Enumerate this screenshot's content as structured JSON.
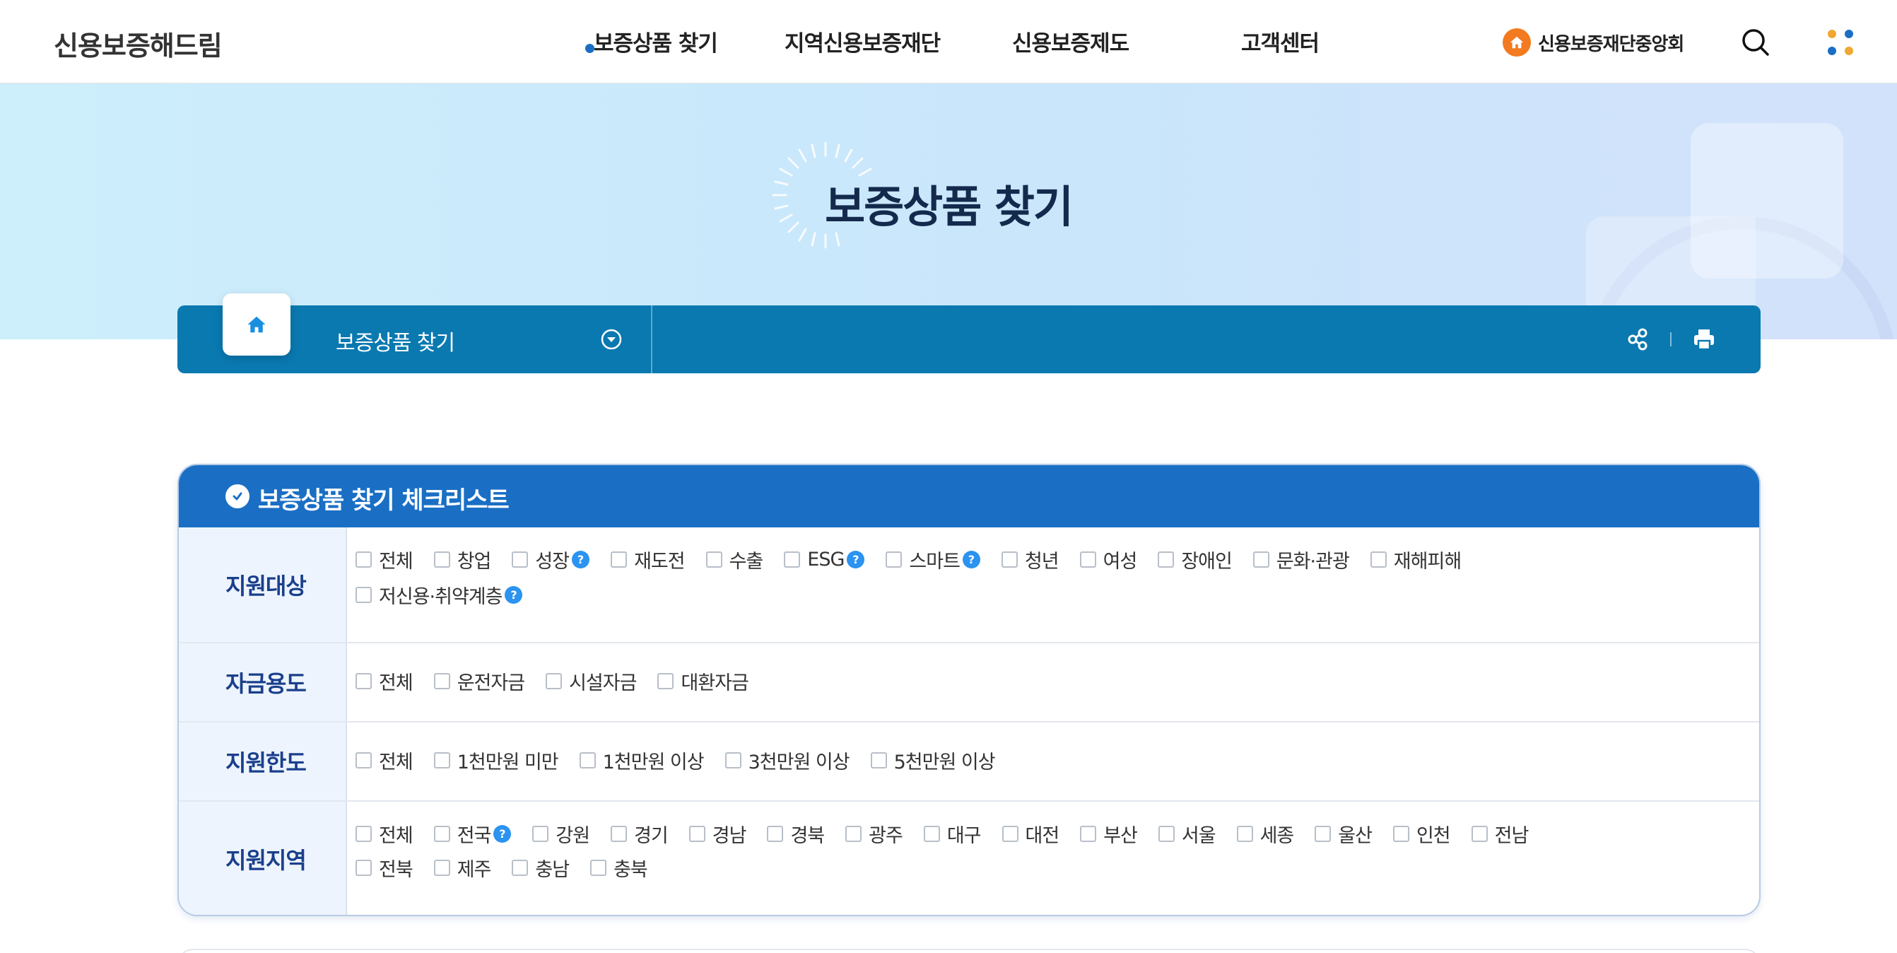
{
  "header": {
    "logo": "신용보증해드림",
    "nav": [
      "보증상품 찾기",
      "지역신용보증재단",
      "신용보증제도",
      "고객센터"
    ],
    "org_link": "신용보증재단중앙회"
  },
  "hero": {
    "title": "보증상품 찾기"
  },
  "breadcrumb": {
    "current": "보증상품 찾기"
  },
  "checklist": {
    "title": "보증상품 찾기 체크리스트",
    "rows": [
      {
        "label": "지원대상",
        "lines": [
          [
            {
              "text": "전체",
              "help": false
            },
            {
              "text": "창업",
              "help": false
            },
            {
              "text": "성장",
              "help": true
            },
            {
              "text": "재도전",
              "help": false
            },
            {
              "text": "수출",
              "help": false
            },
            {
              "text": "ESG",
              "help": true
            },
            {
              "text": "스마트",
              "help": true
            },
            {
              "text": "청년",
              "help": false
            },
            {
              "text": "여성",
              "help": false
            },
            {
              "text": "장애인",
              "help": false
            },
            {
              "text": "문화·관광",
              "help": false
            },
            {
              "text": "재해피해",
              "help": false
            }
          ],
          [
            {
              "text": "저신용·취약계층",
              "help": true
            }
          ]
        ]
      },
      {
        "label": "자금용도",
        "lines": [
          [
            {
              "text": "전체",
              "help": false
            },
            {
              "text": "운전자금",
              "help": false
            },
            {
              "text": "시설자금",
              "help": false
            },
            {
              "text": "대환자금",
              "help": false
            }
          ]
        ]
      },
      {
        "label": "지원한도",
        "lines": [
          [
            {
              "text": "전체",
              "help": false
            },
            {
              "text": "1천만원 미만",
              "help": false
            },
            {
              "text": "1천만원 이상",
              "help": false
            },
            {
              "text": "3천만원 이상",
              "help": false
            },
            {
              "text": "5천만원 이상",
              "help": false
            }
          ]
        ]
      },
      {
        "label": "지원지역",
        "lines": [
          [
            {
              "text": "전체",
              "help": false
            },
            {
              "text": "전국",
              "help": true
            },
            {
              "text": "강원",
              "help": false
            },
            {
              "text": "경기",
              "help": false
            },
            {
              "text": "경남",
              "help": false
            },
            {
              "text": "경북",
              "help": false
            },
            {
              "text": "광주",
              "help": false
            },
            {
              "text": "대구",
              "help": false
            },
            {
              "text": "대전",
              "help": false
            },
            {
              "text": "부산",
              "help": false
            },
            {
              "text": "서울",
              "help": false
            },
            {
              "text": "세종",
              "help": false
            },
            {
              "text": "울산",
              "help": false
            },
            {
              "text": "인천",
              "help": false
            },
            {
              "text": "전남",
              "help": false
            }
          ],
          [
            {
              "text": "전북",
              "help": false
            },
            {
              "text": "제주",
              "help": false
            },
            {
              "text": "충남",
              "help": false
            },
            {
              "text": "충북",
              "help": false
            }
          ]
        ]
      }
    ]
  },
  "help_glyph": "?",
  "colors": {
    "brand_blue": "#1a6fc4",
    "crumb_blue": "#0a79b0",
    "accent_orange": "#f37a1f",
    "help_blue": "#2b93f0",
    "label_navy": "#1a3f8c"
  }
}
